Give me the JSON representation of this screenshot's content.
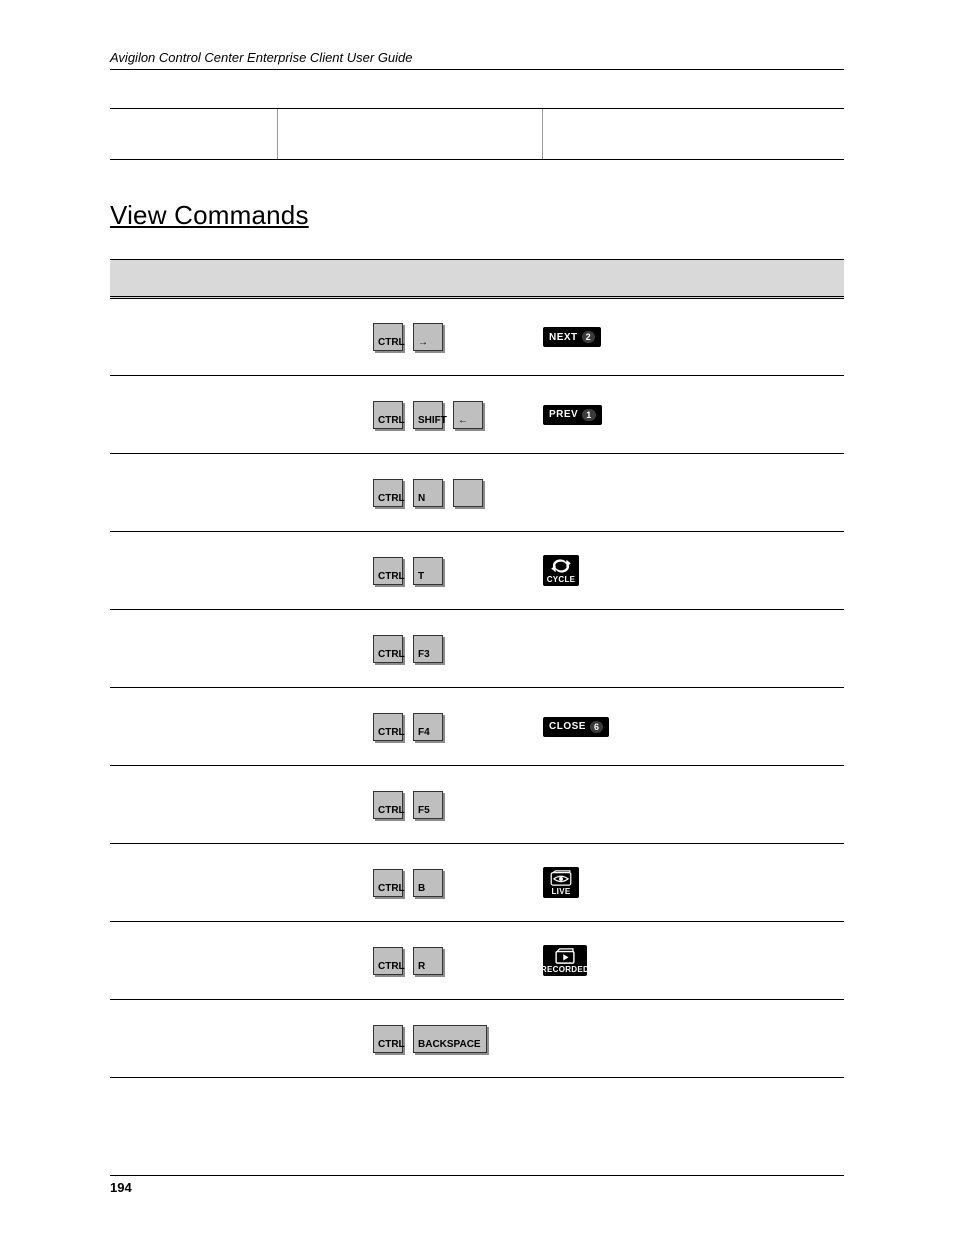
{
  "header": {
    "title": "Avigilon Control Center Enterprise Client User Guide"
  },
  "section": {
    "title": "View Commands"
  },
  "footer": {
    "page": "194"
  },
  "keylabels": {
    "ctrl": "CTRL",
    "shift": "SHIFT",
    "right": "→",
    "left": "←",
    "n": "N",
    "t": "T",
    "f3": "F3",
    "f4": "F4",
    "f5": "F5",
    "b": "B",
    "r": "R",
    "backspace": "BACKSPACE"
  },
  "buttons": {
    "next": {
      "label": "NEXT",
      "num": "2"
    },
    "prev": {
      "label": "PREV",
      "num": "1"
    },
    "close": {
      "label": "CLOSE",
      "num": "6"
    },
    "cycle": {
      "label": "CYCLE"
    },
    "live": {
      "label": "LIVE"
    },
    "recorded": {
      "label": "RECORDED"
    }
  }
}
